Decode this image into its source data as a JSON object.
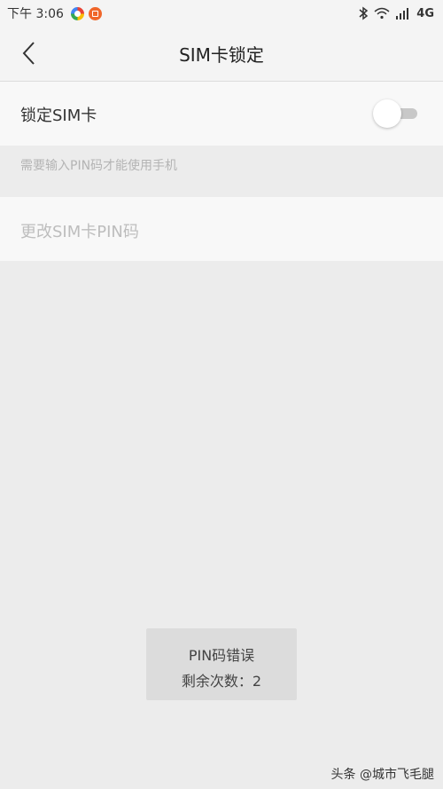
{
  "status_bar": {
    "time": "下午 3:06",
    "network": "4G",
    "icons": [
      "app-icon-colorful",
      "app-icon-orange",
      "bluetooth-icon",
      "wifi-icon",
      "signal-icon"
    ]
  },
  "header": {
    "title": "SIM卡锁定",
    "back_icon": "chevron-left-icon"
  },
  "settings": {
    "lock_sim_label": "锁定SIM卡",
    "lock_sim_enabled": false,
    "helper_text": "需要输入PIN码才能使用手机",
    "change_pin_label": "更改SIM卡PIN码"
  },
  "toast": {
    "line1": "PIN码错误",
    "line2": "剩余次数：2"
  },
  "watermark": "头条 @城市飞毛腿",
  "colors": {
    "background": "#ececec",
    "row_background": "#f8f8f8",
    "toast_background": "#dcdcdc",
    "disabled_text": "#bdbdbd"
  }
}
